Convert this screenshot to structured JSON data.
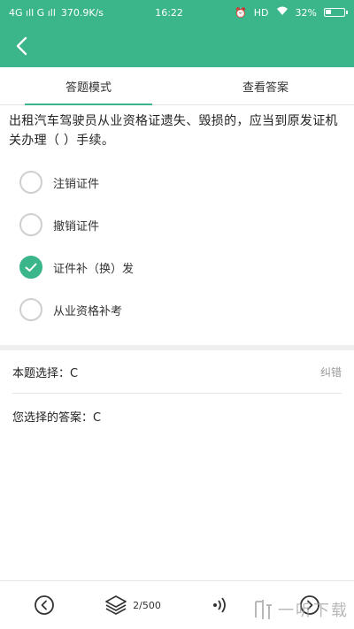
{
  "status_bar": {
    "network": "4G ıll G ıll",
    "speed": "370.9K/s",
    "time": "16:22",
    "indicators": "HD",
    "battery": "32%",
    "battery_level": 0.32
  },
  "app_bar": {
    "back_icon": "chevron-left-icon"
  },
  "tabs": [
    {
      "label": "答题模式",
      "active": true
    },
    {
      "label": "查看答案",
      "active": false
    }
  ],
  "question": {
    "text": "出租汽车驾驶员从业资格证遗失、毁损的，应当到原发证机关办理（ ）手续。"
  },
  "options": [
    {
      "label": "注销证件",
      "selected": false
    },
    {
      "label": "撤销证件",
      "selected": false
    },
    {
      "label": "证件补（换）发",
      "selected": true
    },
    {
      "label": "从业资格补考",
      "selected": false
    }
  ],
  "result": {
    "correct_answer": "本题选择：C",
    "report_label": "纠错",
    "your_answer": "您选择的答案：C"
  },
  "bottom_nav": {
    "prev_icon": "prev-circle-icon",
    "layers_icon": "layers-icon",
    "progress": "2/500",
    "audio_icon": "audio-icon",
    "next_icon": "next-circle-icon"
  },
  "watermark": {
    "text": "一听下载"
  },
  "colors": {
    "accent": "#3bb58a"
  }
}
